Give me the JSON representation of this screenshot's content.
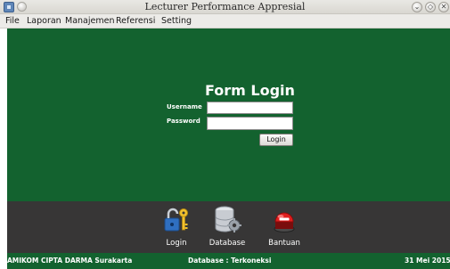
{
  "window": {
    "title": "Lecturer Performance Appresial",
    "controls": {
      "minimize": "⌄",
      "maximize": "◇",
      "close": "✕"
    }
  },
  "menu": {
    "items": [
      "File",
      "Laporan",
      "Manajemen",
      "Referensi",
      "Setting"
    ]
  },
  "login_form": {
    "title": "Form Login",
    "username_label": "Username",
    "username_value": "",
    "password_label": "Password",
    "password_value": "",
    "login_button": "Login"
  },
  "toolbar": {
    "items": [
      {
        "label": "Login",
        "icon": "padlock-key-icon"
      },
      {
        "label": "Database",
        "icon": "database-gear-icon"
      },
      {
        "label": "Bantuan",
        "icon": "help-alarm-button-icon"
      }
    ]
  },
  "status": {
    "institution": "AMIKOM CIPTA DARMA Surakarta",
    "database": "Database : Terkoneksi",
    "date": "31 Mei 2015"
  },
  "colors": {
    "form_background": "#13622f",
    "toolbar_background": "#373636",
    "status_background": "#13622f"
  }
}
